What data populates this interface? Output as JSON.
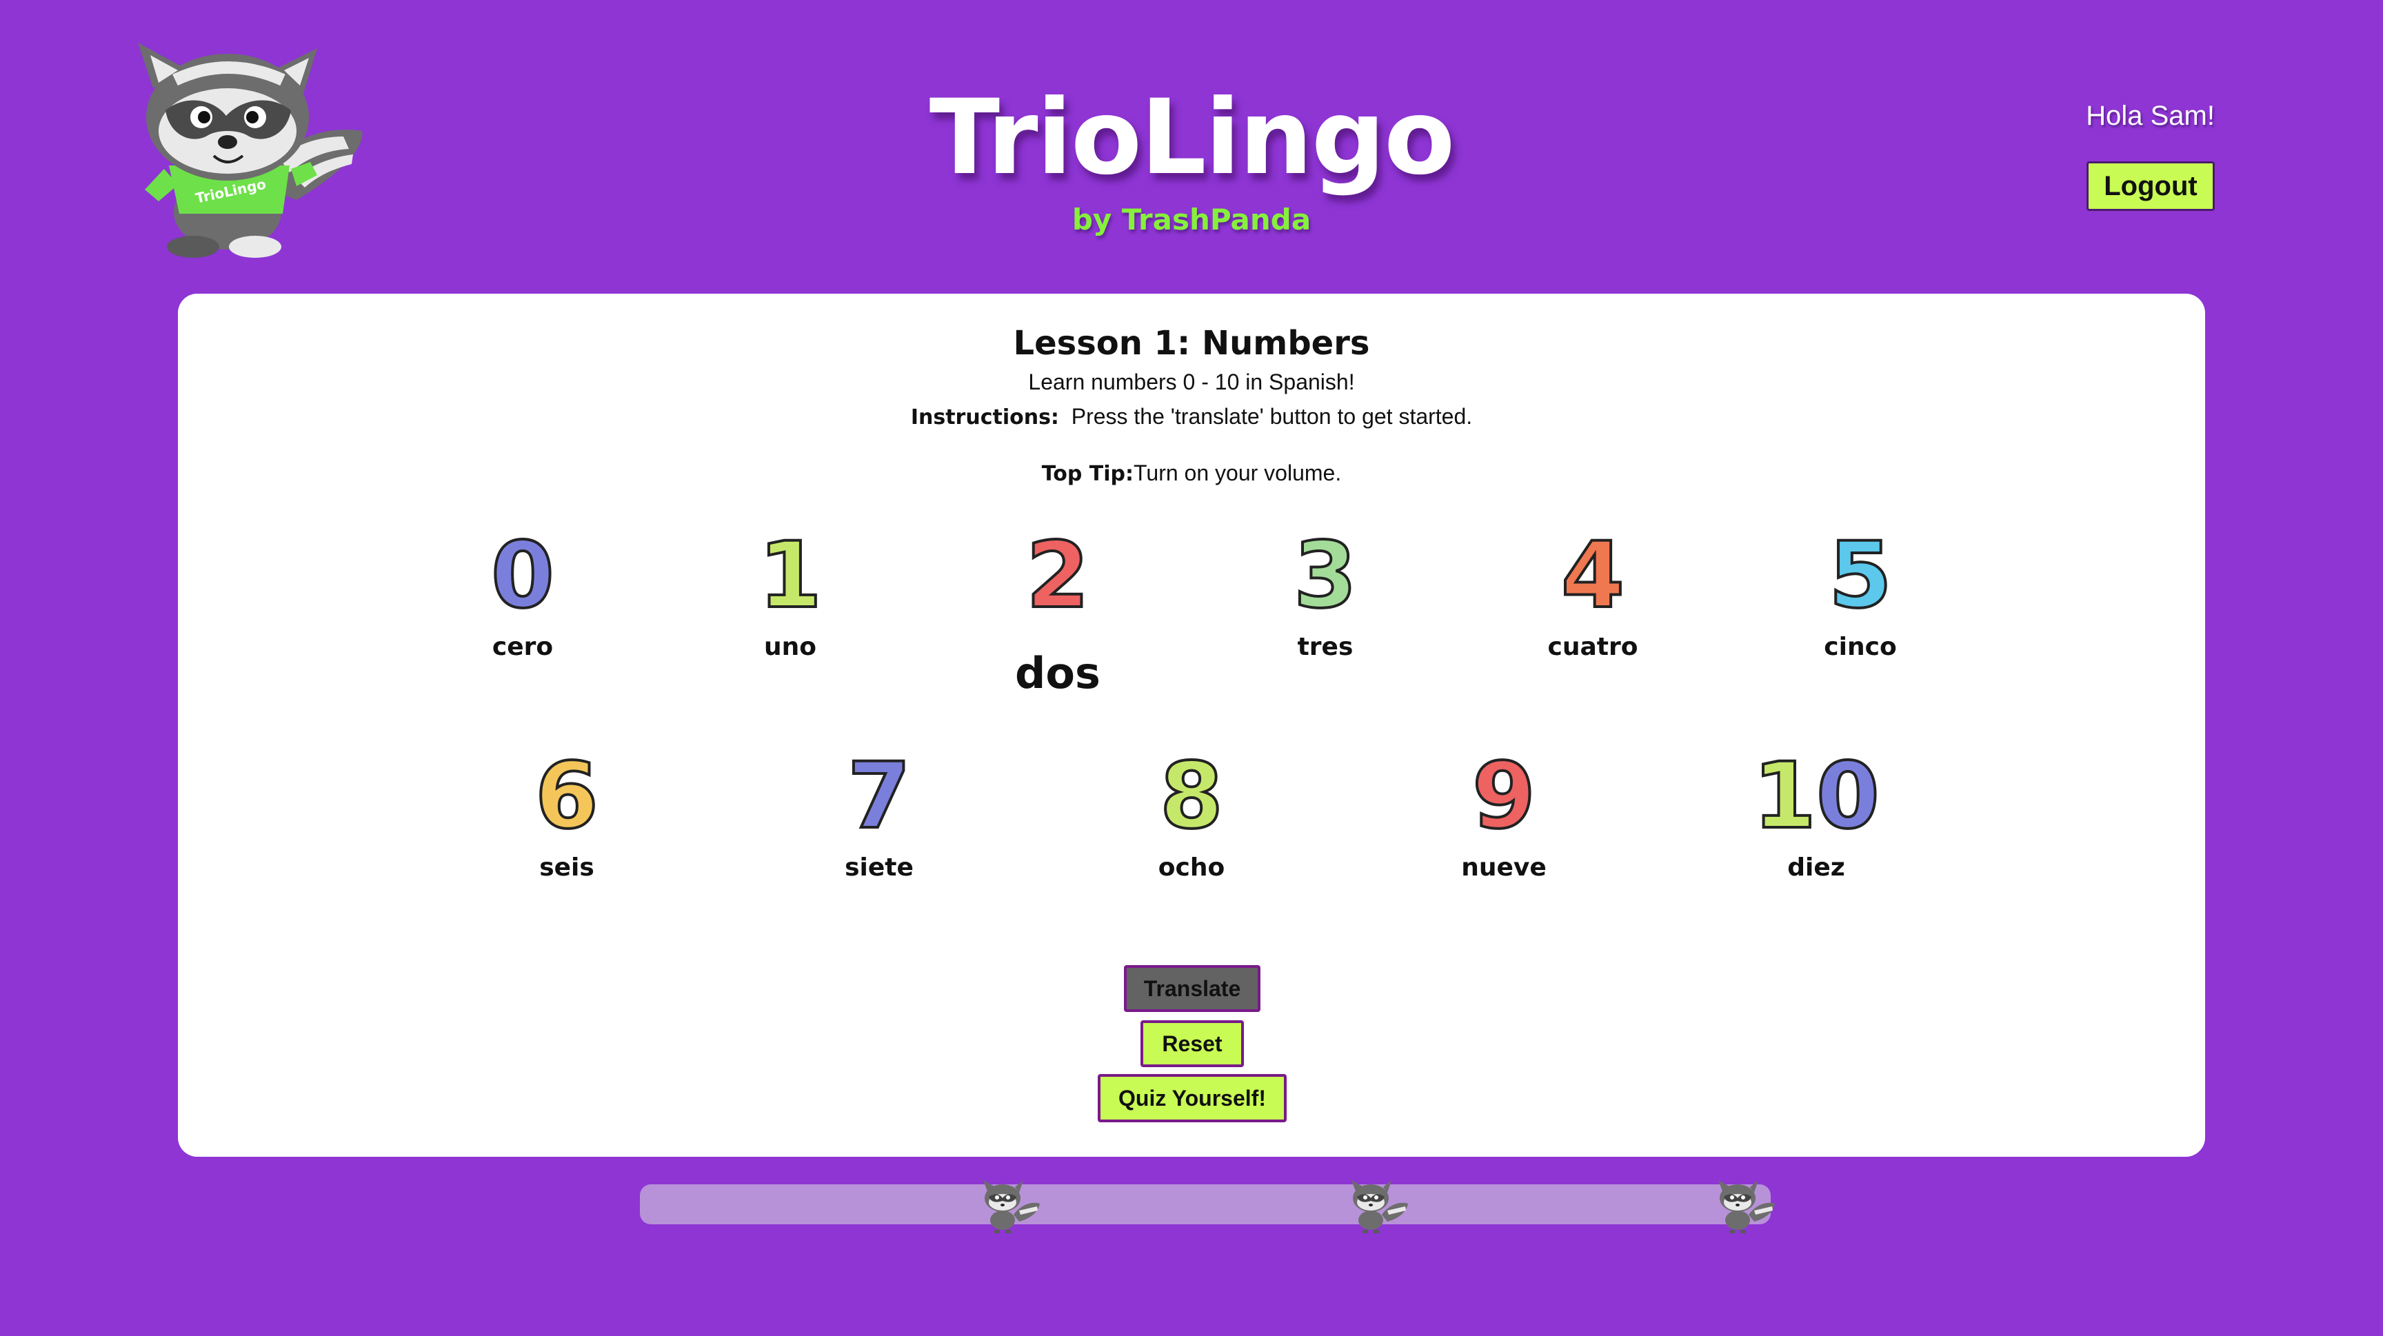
{
  "header": {
    "title": "TrioLingo",
    "subtitle": "by TrashPanda",
    "greeting": "Hola Sam!",
    "logout_label": "Logout",
    "mascot_shirt_text": "TrioLingo"
  },
  "lesson": {
    "title": "Lesson 1: Numbers",
    "description": "Learn numbers 0 - 10 in Spanish!",
    "instructions_label": "Instructions:",
    "instructions_text": "Press the 'translate' button to get started.",
    "tip_label": "Top Tip:",
    "tip_text": "Turn on your volume."
  },
  "numbers": [
    {
      "digit": "0",
      "word": "cero",
      "color": "#7b7fdc"
    },
    {
      "digit": "1",
      "word": "uno",
      "color": "#c6e86a"
    },
    {
      "digit": "2",
      "word": "dos",
      "color": "#ee6262"
    },
    {
      "digit": "3",
      "word": "tres",
      "color": "#a3dc98"
    },
    {
      "digit": "4",
      "word": "cuatro",
      "color": "#f07850"
    },
    {
      "digit": "5",
      "word": "cinco",
      "color": "#5cc8ec"
    },
    {
      "digit": "6",
      "word": "seis",
      "color": "#f4c65a"
    },
    {
      "digit": "7",
      "word": "siete",
      "color": "#7b7fdc"
    },
    {
      "digit": "8",
      "word": "ocho",
      "color": "#c6e86a"
    },
    {
      "digit": "9",
      "word": "nueve",
      "color": "#ee6262"
    },
    {
      "digit": "10",
      "word": "diez",
      "color": "#c6e86a",
      "color2": "#7b7fdc"
    }
  ],
  "highlighted_number": "2",
  "buttons": {
    "translate": "Translate",
    "reset": "Reset",
    "quiz": "Quiz Yourself!"
  },
  "progress": {
    "markers": 3
  },
  "colors": {
    "background": "#8e35d4",
    "accent_green": "#c8fb53",
    "brand_green": "#86f03c",
    "card": "#ffffff",
    "progress_track": "#b892d8"
  }
}
